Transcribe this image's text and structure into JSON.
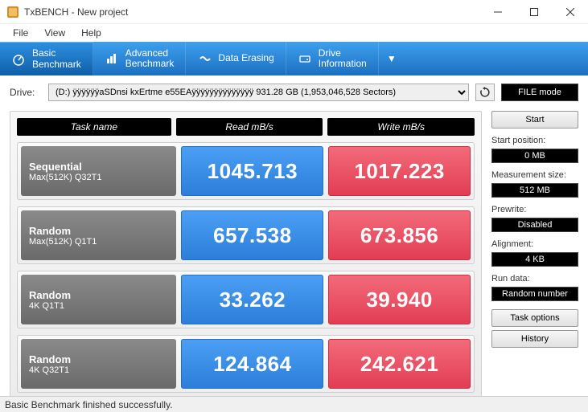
{
  "window": {
    "title": "TxBENCH - New project"
  },
  "menu": {
    "file": "File",
    "view": "View",
    "help": "Help"
  },
  "tabs": {
    "basic": "Basic\nBenchmark",
    "advanced": "Advanced\nBenchmark",
    "erase": "Data Erasing",
    "drive": "Drive\nInformation"
  },
  "drive": {
    "label": "Drive:",
    "value": "(D:) ÿÿÿÿÿÿaSDnsi kxErtme e55EAÿÿÿÿÿÿÿÿÿÿÿÿÿÿ  931.28 GB (1,953,046,528 Sectors)",
    "filemode": "FILE mode"
  },
  "headers": {
    "task": "Task name",
    "read": "Read mB/s",
    "write": "Write mB/s"
  },
  "rows": [
    {
      "t1": "Sequential",
      "t2": "Max(512K) Q32T1",
      "read": "1045.713",
      "write": "1017.223"
    },
    {
      "t1": "Random",
      "t2": "Max(512K) Q1T1",
      "read": "657.538",
      "write": "673.856"
    },
    {
      "t1": "Random",
      "t2": "4K Q1T1",
      "read": "33.262",
      "write": "39.940"
    },
    {
      "t1": "Random",
      "t2": "4K Q32T1",
      "read": "124.864",
      "write": "242.621"
    }
  ],
  "side": {
    "start": "Start",
    "startpos_lbl": "Start position:",
    "startpos": "0 MB",
    "meas_lbl": "Measurement size:",
    "meas": "512 MB",
    "pre_lbl": "Prewrite:",
    "pre": "Disabled",
    "align_lbl": "Alignment:",
    "align": "4 KB",
    "data_lbl": "Run data:",
    "data": "Random number",
    "taskopt": "Task options",
    "history": "History"
  },
  "status": "Basic Benchmark finished successfully."
}
